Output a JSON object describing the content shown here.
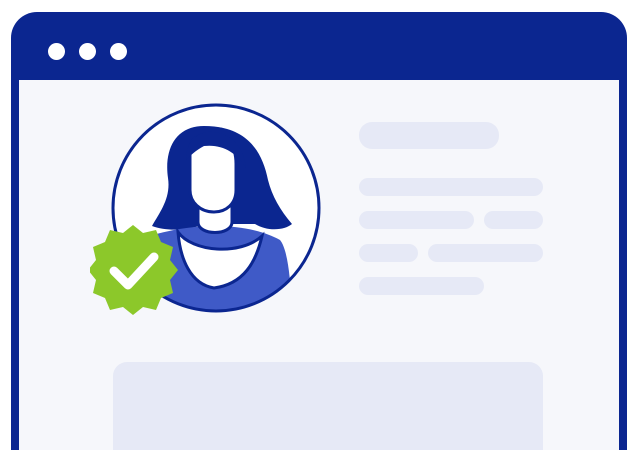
{
  "window": {
    "titlebar_dots": [
      "dot",
      "dot",
      "dot"
    ]
  },
  "profile": {
    "avatar_icon": "woman-avatar-icon",
    "verified_icon": "verified-check-badge-icon",
    "colors": {
      "frame": "#0b2690",
      "hair": "#0b2690",
      "shirt": "#3f5ac7",
      "badge": "#8cc82a",
      "placeholder": "#e6e9f6",
      "background": "#f6f7fb"
    }
  }
}
